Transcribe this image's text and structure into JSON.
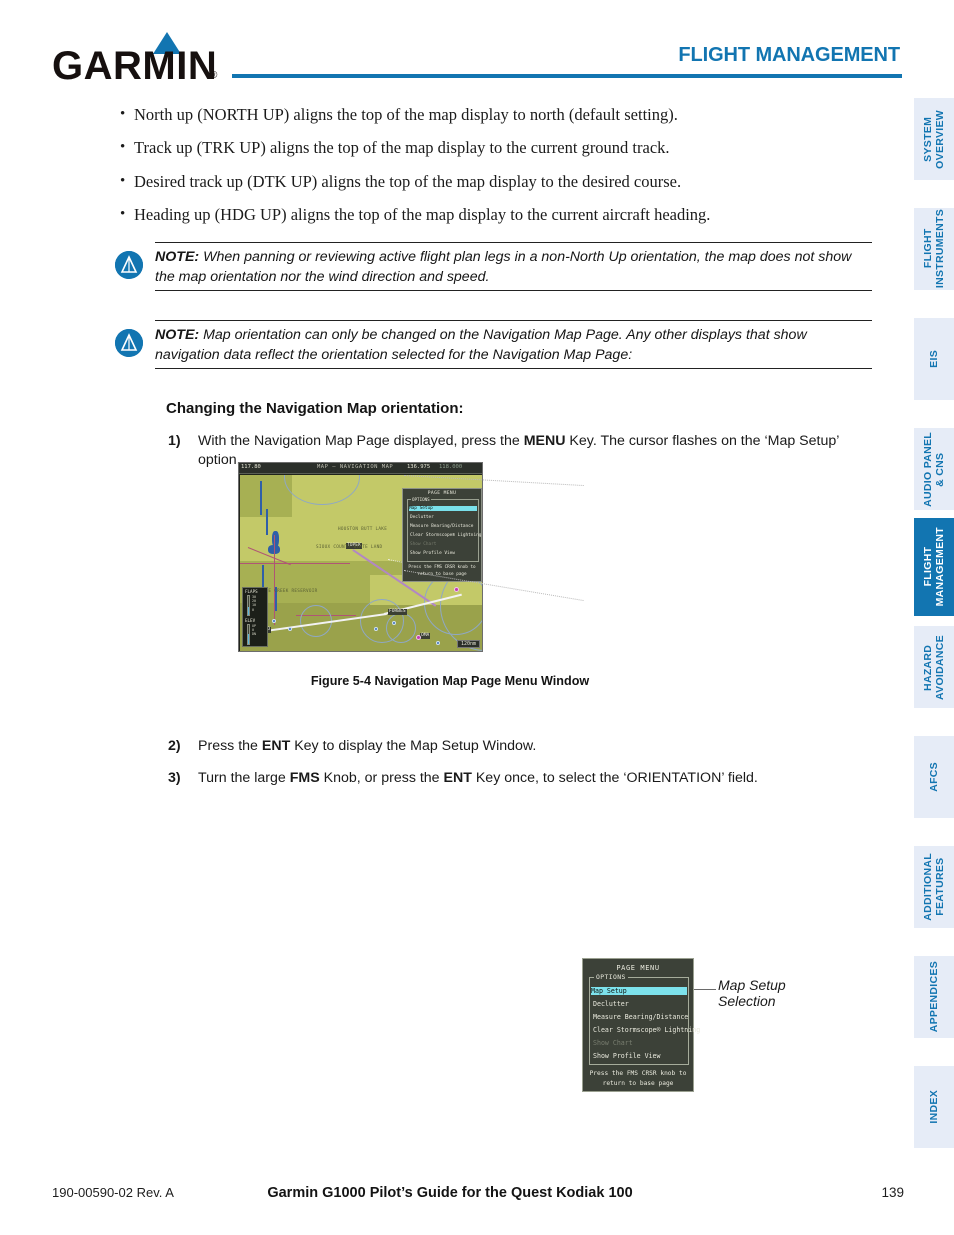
{
  "header": {
    "logo_text": "GARMIN",
    "logo_registered": "®",
    "title": "FLIGHT MANAGEMENT",
    "accent_color": "#1275b1"
  },
  "sidebar": {
    "active_index": 4,
    "items": [
      {
        "label": "SYSTEM\nOVERVIEW",
        "active": false
      },
      {
        "label": "FLIGHT\nINSTRUMENTS",
        "active": false
      },
      {
        "label": "EIS",
        "active": false
      },
      {
        "label": "AUDIO PANEL\n& CNS",
        "active": false
      },
      {
        "label": "FLIGHT\nMANAGEMENT",
        "active": true
      },
      {
        "label": "HAZARD\nAVOIDANCE",
        "active": false
      },
      {
        "label": "AFCS",
        "active": false
      },
      {
        "label": "ADDITIONAL\nFEATURES",
        "active": false
      },
      {
        "label": "APPENDICES",
        "active": false
      },
      {
        "label": "INDEX",
        "active": false
      }
    ]
  },
  "body": {
    "bullets": [
      "North up (NORTH UP) aligns the top of the map display to north (default setting).",
      "Track up (TRK UP) aligns the top of the map display to the current ground track.",
      "Desired track up (DTK UP) aligns the top of the map display to the desired course.",
      "Heading up (HDG UP) aligns the top of the map display to the current aircraft heading."
    ],
    "notes": [
      {
        "label": "NOTE:",
        "text": " When panning or reviewing active flight plan legs in a non-North Up orientation, the map does not show the map orientation nor the wind direction and speed."
      },
      {
        "label": "NOTE:",
        "text": " Map orientation can only be changed on the Navigation Map Page.  Any other displays that show navigation data reflect the orientation selected for the Navigation Map Page:"
      }
    ],
    "procedure_heading": "Changing the Navigation Map orientation:",
    "steps": [
      {
        "num": "1)",
        "pre": "With the Navigation Map Page displayed, press the ",
        "bold": "MENU",
        "post": " Key.  The cursor flashes on the ‘Map Setup’ option."
      },
      {
        "num": "2)",
        "pre": "Press the ",
        "bold": "ENT",
        "post": " Key to display the Map Setup Window."
      },
      {
        "num": "3)",
        "pre": "Turn the large ",
        "bold": "FMS",
        "post": " Knob, or press the ",
        "bold2": "ENT",
        "post2": " Key once, to select the ‘ORIENTATION’ field."
      }
    ]
  },
  "figure": {
    "caption": "Figure 5-4  Navigation Map Page Menu Window",
    "callout_label": "Map Setup\nSelection",
    "mfd": {
      "topbar": {
        "nav_freq": "117.80",
        "page_title": "MAP – NAVIGATION MAP",
        "com_active": "136.975",
        "com_standby": "118.000",
        "com_standby_unit": "COM2"
      },
      "map_labels": [
        "HOUSTON BUTT LAKE",
        "SIOUX COUNTY STATE LAND",
        "TUTTLE CREEK RESERVOIR"
      ],
      "waypoints": [
        "TOPEK",
        "FORBES",
        "KOKO",
        "OMA"
      ],
      "range": "120nm",
      "gauges": [
        {
          "name": "FLAPS",
          "ticks": [
            "30",
            "20",
            "10",
            "0"
          ]
        },
        {
          "name": "ELEV",
          "ticks": [
            "UP",
            "0",
            "DN"
          ]
        }
      ]
    },
    "page_menu": {
      "title": "PAGE MENU",
      "group_label": "OPTIONS",
      "items": [
        {
          "label": "Map Setup",
          "selected": true,
          "disabled": false
        },
        {
          "label": "Declutter",
          "selected": false,
          "disabled": false
        },
        {
          "label": "Measure Bearing/Distance",
          "selected": false,
          "disabled": false
        },
        {
          "label": "Clear Stormscope® Lightning",
          "selected": false,
          "disabled": false
        },
        {
          "label": "Show Chart",
          "selected": false,
          "disabled": true
        },
        {
          "label": "Show Profile View",
          "selected": false,
          "disabled": false
        }
      ],
      "footer_line1": "Press the FMS CRSR knob to",
      "footer_line2": "return to base page"
    }
  },
  "footer": {
    "left": "190-00590-02  Rev. A",
    "center": "Garmin G1000 Pilot’s Guide for the Quest Kodiak 100",
    "right": "139"
  }
}
